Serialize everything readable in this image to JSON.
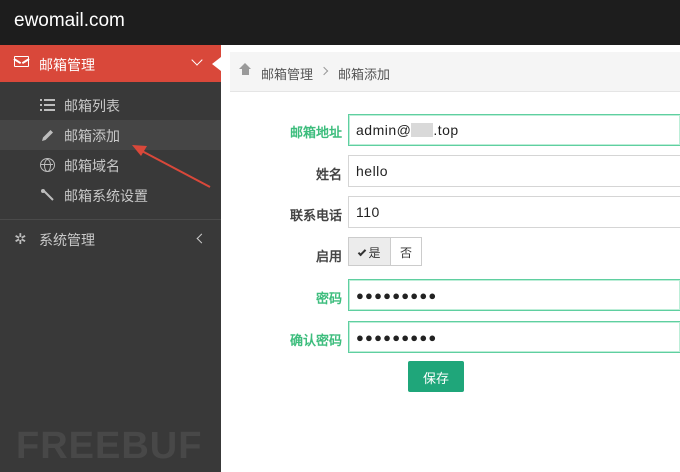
{
  "app": {
    "brand": "ewomail.com"
  },
  "sidebar": {
    "mail_menu": {
      "label": "邮箱管理",
      "icon": "envelope-icon"
    },
    "sub_items": [
      {
        "label": "邮箱列表",
        "icon": "list-icon"
      },
      {
        "label": "邮箱添加",
        "icon": "pencil-icon",
        "active": true
      },
      {
        "label": "邮箱域名",
        "icon": "globe-icon"
      },
      {
        "label": "邮箱系统设置",
        "icon": "wrench-icon"
      }
    ],
    "system_menu": {
      "label": "系统管理",
      "icon": "gear-icon"
    },
    "watermark": "FREEBUF"
  },
  "breadcrumb": {
    "home": "邮箱管理",
    "current": "邮箱添加"
  },
  "form": {
    "email": {
      "label": "邮箱地址",
      "value_prefix": "admin@",
      "value_suffix": ".top"
    },
    "name": {
      "label": "姓名",
      "value": "hello"
    },
    "phone": {
      "label": "联系电话",
      "value": "110"
    },
    "enabled": {
      "label": "启用",
      "yes": "是",
      "no": "否",
      "selected": "是"
    },
    "password": {
      "label": "密码",
      "masked": "●●●●●●●●●"
    },
    "confirm_password": {
      "label": "确认密码",
      "masked": "●●●●●●●●●"
    },
    "save": "保存"
  },
  "colors": {
    "accent_red": "#d9483a",
    "save_green": "#1fa67a",
    "label_green": "#3dbd7d"
  }
}
